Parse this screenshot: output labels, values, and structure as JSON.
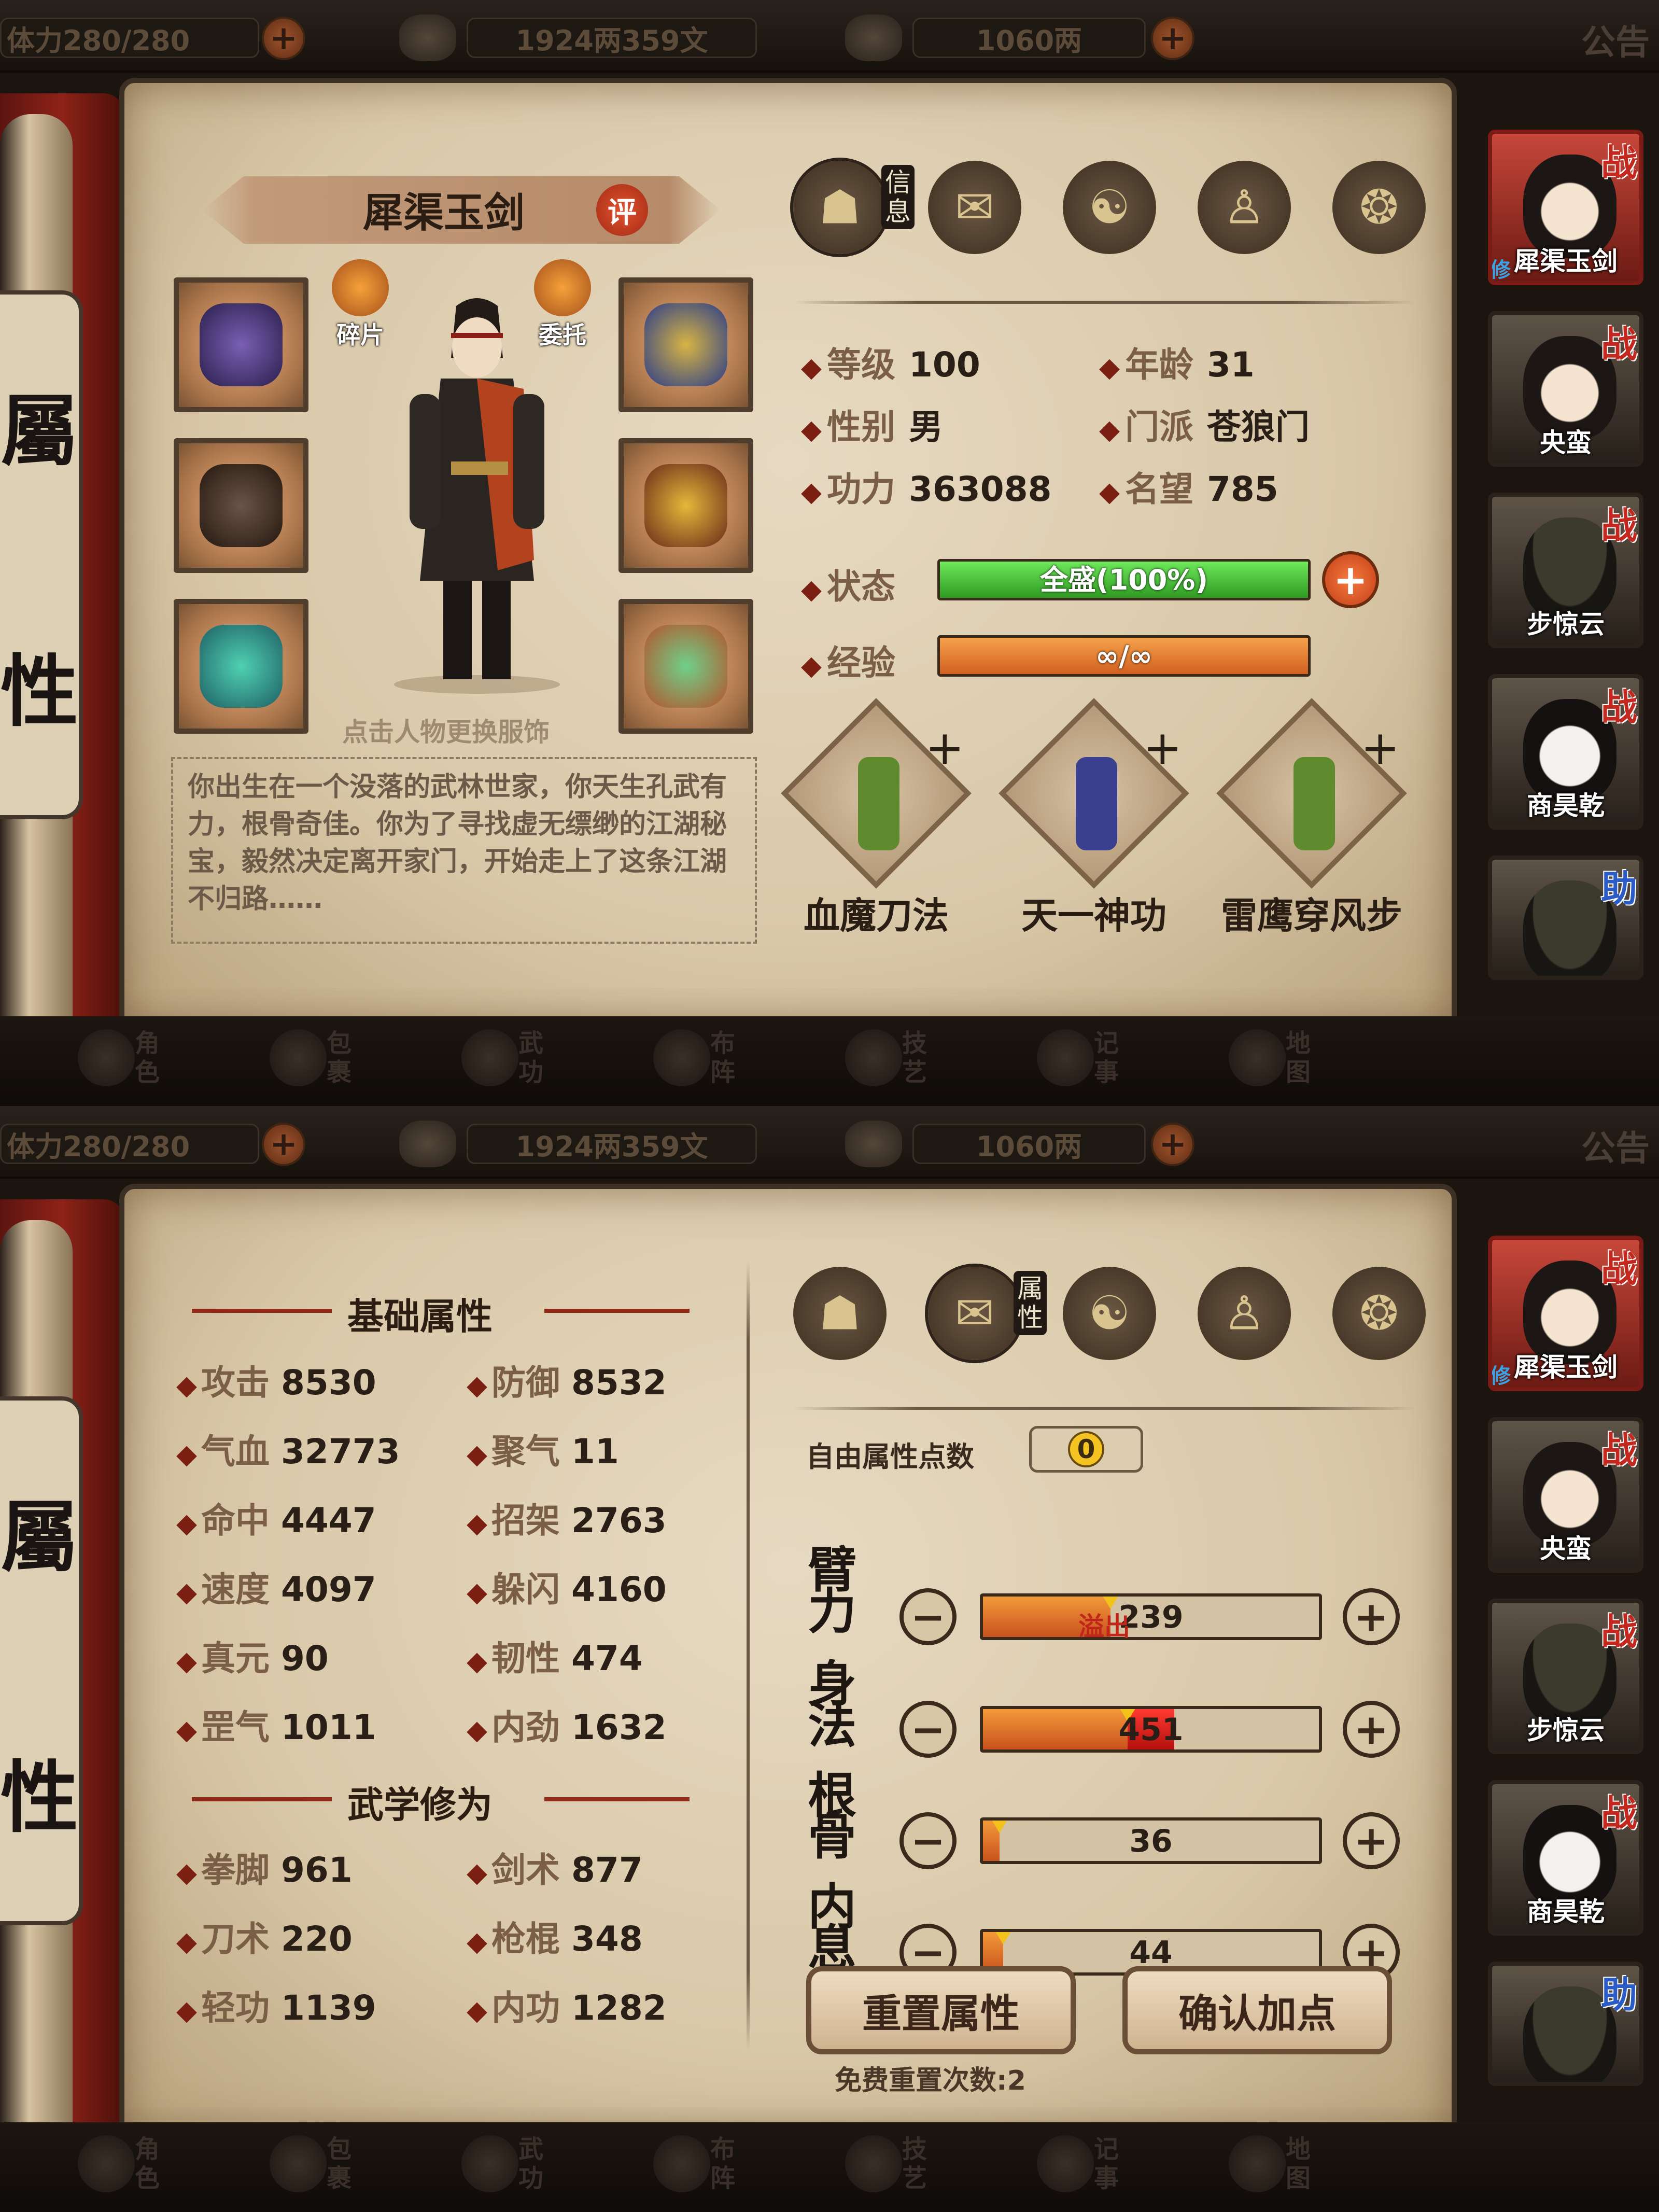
{
  "topbar": {
    "stamina": "体力280/280",
    "money": "1924两359文",
    "gold": "1060两",
    "notice": "公告",
    "plus": "+"
  },
  "side_tab": [
    "屬",
    "性"
  ],
  "bottom_nav": [
    {
      "label": "角色",
      "icon": "character-icon"
    },
    {
      "label": "包裹",
      "icon": "bag-icon"
    },
    {
      "label": "武功",
      "icon": "martial-book-icon"
    },
    {
      "label": "布阵",
      "icon": "formation-icon"
    },
    {
      "label": "技艺",
      "icon": "skill-icon"
    },
    {
      "label": "记事",
      "icon": "journal-icon"
    },
    {
      "label": "地图",
      "icon": "map-icon"
    }
  ],
  "tabs": {
    "info_label": "信息",
    "attr_label": "属性"
  },
  "roster": [
    {
      "name": "犀渠玉剑",
      "badge": "战",
      "selected": true,
      "tag": "修"
    },
    {
      "name": "央蛮",
      "badge": "战"
    },
    {
      "name": "步惊云",
      "badge": "战"
    },
    {
      "name": "商昊乾",
      "badge": "战"
    },
    {
      "name": "",
      "badge": "助"
    }
  ],
  "info": {
    "hero_name": "犀渠玉剑",
    "rate": "评",
    "fragments": "碎片",
    "entrust": "委托",
    "hint": "点击人物更换服饰",
    "description": "你出生在一个没落的武林世家，你天生孔武有力，根骨奇佳。你为了寻找虚无缥缈的江湖秘宝，毅然决定离开家门，开始走上了这条江湖不归路……",
    "stats": [
      {
        "label": "等级",
        "value": "100"
      },
      {
        "label": "年龄",
        "value": "31"
      },
      {
        "label": "性别",
        "value": "男"
      },
      {
        "label": "门派",
        "value": "苍狼门"
      },
      {
        "label": "功力",
        "value": "363088"
      },
      {
        "label": "名望",
        "value": "785"
      }
    ],
    "status_label": "状态",
    "status_text": "全盛(100%)",
    "status_pct": 100,
    "exp_label": "经验",
    "exp_text": "∞/∞",
    "skills": [
      {
        "name": "血魔刀法",
        "color": "#5f8b2e"
      },
      {
        "name": "天一神功",
        "color": "#3b3f8f"
      },
      {
        "name": "雷鹰穿风步",
        "color": "#5f8b2e"
      }
    ],
    "skill_plus": "+"
  },
  "attrs": {
    "basic_header": "基础属性",
    "basic": [
      {
        "label": "攻击",
        "value": "8530"
      },
      {
        "label": "防御",
        "value": "8532"
      },
      {
        "label": "气血",
        "value": "32773"
      },
      {
        "label": "聚气",
        "value": "11"
      },
      {
        "label": "命中",
        "value": "4447"
      },
      {
        "label": "招架",
        "value": "2763"
      },
      {
        "label": "速度",
        "value": "4097"
      },
      {
        "label": "躲闪",
        "value": "4160"
      },
      {
        "label": "真元",
        "value": "90"
      },
      {
        "label": "韧性",
        "value": "474"
      },
      {
        "label": "罡气",
        "value": "1011"
      },
      {
        "label": "内劲",
        "value": "1632"
      }
    ],
    "martial_header": "武学修为",
    "martial": [
      {
        "label": "拳脚",
        "value": "961"
      },
      {
        "label": "剑术",
        "value": "877"
      },
      {
        "label": "刀术",
        "value": "220"
      },
      {
        "label": "枪棍",
        "value": "348"
      },
      {
        "label": "轻功",
        "value": "1139"
      },
      {
        "label": "内功",
        "value": "1282"
      }
    ],
    "free_points_label": "自由属性点数",
    "free_points": "0",
    "minus": "−",
    "plus": "+",
    "overflow_label": "溢出",
    "alloc": [
      {
        "label": "臂力",
        "value": "239",
        "fill": 0.38,
        "overflow": 0
      },
      {
        "label": "身法",
        "value": "451",
        "fill": 0.43,
        "overflow": 0.14
      },
      {
        "label": "根骨",
        "value": "36",
        "fill": 0.05,
        "overflow": 0
      },
      {
        "label": "内息",
        "value": "44",
        "fill": 0.06,
        "overflow": 0
      }
    ],
    "reset_button": "重置属性",
    "confirm_button": "确认加点",
    "free_reset": "免费重置次数:2"
  }
}
